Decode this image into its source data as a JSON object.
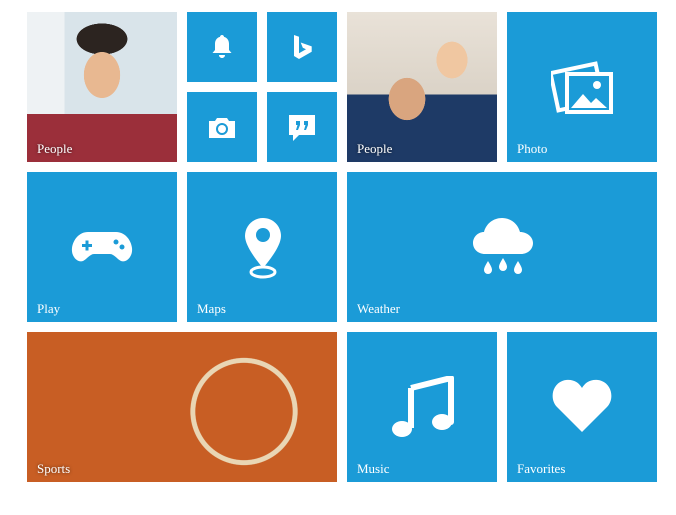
{
  "colors": {
    "tile_blue": "#1b9bd7",
    "text": "#ffffff"
  },
  "tiles": {
    "people_1": {
      "label": "People",
      "icon": "person-photo"
    },
    "notifications": {
      "icon": "bell-icon"
    },
    "bing": {
      "icon": "bing-icon"
    },
    "camera": {
      "icon": "camera-icon"
    },
    "messaging": {
      "icon": "quote-icon"
    },
    "people_2": {
      "label": "People",
      "icon": "family-photo"
    },
    "photo": {
      "label": "Photo",
      "icon": "photos-icon"
    },
    "play": {
      "label": "Play",
      "icon": "gamepad-icon"
    },
    "maps": {
      "label": "Maps",
      "icon": "map-pin-icon"
    },
    "weather": {
      "label": "Weather",
      "icon": "rain-cloud-icon"
    },
    "sports": {
      "label": "Sports",
      "icon": "basketball-photo"
    },
    "music": {
      "label": "Music",
      "icon": "music-note-icon"
    },
    "favorites": {
      "label": "Favorites",
      "icon": "heart-icon"
    }
  }
}
